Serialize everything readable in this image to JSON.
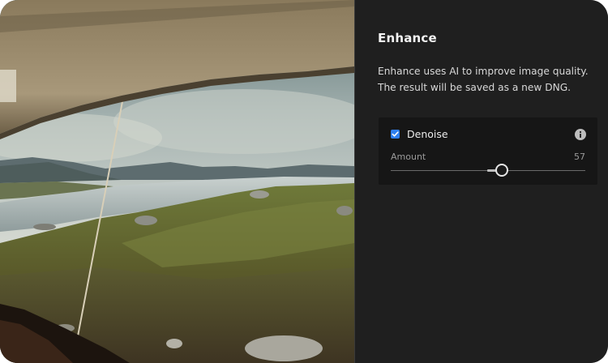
{
  "photo": {
    "description_icon": "image-preview-icon"
  },
  "enhance": {
    "title": "Enhance",
    "description": "Enhance uses AI to improve image quality. The result will be saved as a new DNG.",
    "denoise": {
      "label": "Denoise",
      "checked": true,
      "info_icon": "info-icon",
      "amount_label": "Amount",
      "amount_value": "57",
      "amount_min": 0,
      "amount_max": 100,
      "amount": 57
    }
  },
  "colors": {
    "panel_bg": "#1f1f1f",
    "card_bg": "#161616",
    "accent": "#2f7ff0"
  }
}
